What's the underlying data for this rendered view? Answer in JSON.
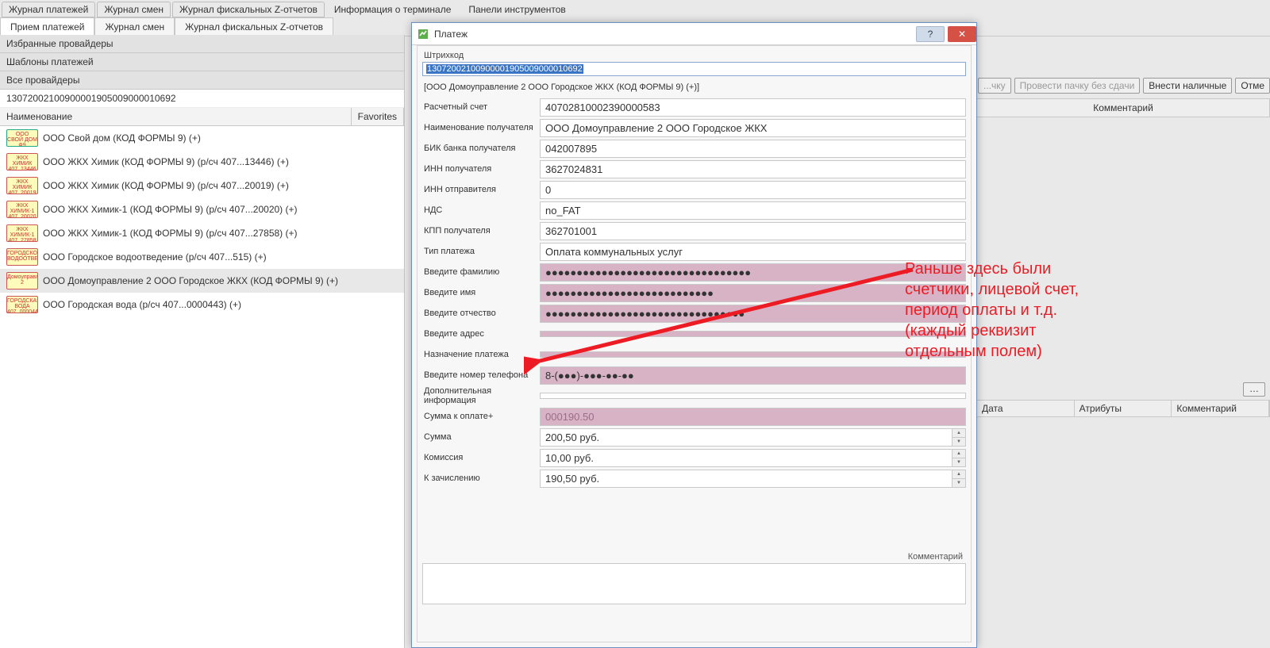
{
  "bgTabsTop": [
    {
      "label": "Журнал платежей"
    },
    {
      "label": "Журнал смен"
    },
    {
      "label": "Журнал фискальных Z-отчетов"
    },
    {
      "label": "Информация о терминале",
      "flat": true
    },
    {
      "label": "Панели инструментов",
      "flat": true
    }
  ],
  "bgTabs2": [
    {
      "label": "Прием платежей",
      "active": true
    },
    {
      "label": "Журнал смен"
    },
    {
      "label": "Журнал фискальных Z-отчетов"
    }
  ],
  "sidebar": {
    "favProv": "Избранные провайдеры",
    "templates": "Шаблоны платежей",
    "allProv": "Все провайдеры",
    "providerNumber": "13072002100900001905009000010692",
    "colName": "Наименование",
    "colFav": "Favorites",
    "items": [
      {
        "label": "ООО Свой дом (КОД ФОРМЫ 9) (+)",
        "logo": "ООО СВОЙ ДОМ Ф9",
        "green": true
      },
      {
        "label": "ООО ЖКХ Химик (КОД ФОРМЫ 9) (р/сч 407...13446) (+)",
        "logo": "ЖКХ ХИМИК 407..13446"
      },
      {
        "label": "ООО ЖКХ Химик (КОД ФОРМЫ 9) (р/сч 407...20019) (+)",
        "logo": "ЖКХ ХИМИК 407..20019"
      },
      {
        "label": "ООО ЖКХ Химик-1 (КОД ФОРМЫ 9) (р/сч 407...20020) (+)",
        "logo": "ЖКХ ХИМИК-1 407..20020"
      },
      {
        "label": "ООО ЖКХ Химик-1 (КОД ФОРМЫ 9) (р/сч 407...27858) (+)",
        "logo": "ЖКХ ХИМИК-1 407..27858"
      },
      {
        "label": "ООО Городское водоотведение (р/сч 407...515) (+)",
        "logo": "ГОРОДСКОЕ ВОДООТВЕДЕНИЕ"
      },
      {
        "label": "ООО Домоуправление 2 ООО Городское ЖКХ (КОД ФОРМЫ 9) (+)",
        "logo": "Домоуправление 2",
        "sel": true
      },
      {
        "label": "ООО Городская вода (р/сч 407...0000443) (+)",
        "logo": "ГОРОДСКАЯ ВОДА 407..0000443"
      }
    ]
  },
  "rightButtons": {
    "pack": "...чку",
    "packNoChange": "Провести пачку без сдачи",
    "cashIn": "Внести наличные",
    "cancel": "Отме"
  },
  "rightHeader": "Комментарий",
  "rightCols": {
    "date": "Дата",
    "attrs": "Атрибуты",
    "comment": "Комментарий"
  },
  "dialog": {
    "title": "Платеж",
    "barcodeLabel": "Штрихкод",
    "barcodeValue": "13072002100900001905009000010692",
    "bracket": "[ООО Домоуправление 2 ООО Городское ЖКХ (КОД ФОРМЫ 9) (+)]",
    "fields": [
      {
        "label": "Расчетный счет",
        "value": "40702810002390000583"
      },
      {
        "label": "Наименование получателя",
        "value": "ООО Домоуправление 2 ООО Городское ЖКХ"
      },
      {
        "label": "БИК банка получателя",
        "value": "042007895"
      },
      {
        "label": "ИНН получателя",
        "value": "3627024831"
      },
      {
        "label": "ИНН отправителя",
        "value": "0"
      },
      {
        "label": "НДС",
        "value": "no_FAT"
      },
      {
        "label": "КПП получателя",
        "value": "362701001"
      },
      {
        "label": "Тип платежа",
        "value": "Оплата коммунальных услуг"
      },
      {
        "label": "Введите фамилию",
        "value": "●●●●●●●●●●●●●●●●●●●●●●●●●●●●●●●●●",
        "req": true
      },
      {
        "label": "Введите имя",
        "value": "●●●●●●●●●●●●●●●●●●●●●●●●●●●",
        "req": true
      },
      {
        "label": "Введите отчество",
        "value": "●●●●●●●●●●●●●●●●●●●●●●●●●●●●●●●●",
        "req": true
      },
      {
        "label": "Введите адрес",
        "value": "",
        "req": true
      },
      {
        "label": "Назначение платежа",
        "value": "",
        "req": true
      },
      {
        "label": "Введите номер телефона",
        "value": "8-(●●●)-●●●-●●-●●",
        "req": true
      },
      {
        "label": "Дополнительная информация",
        "value": ""
      },
      {
        "label": "Сумма к оплате+",
        "value": "000190.50",
        "reqmuted": true
      },
      {
        "label": "Сумма",
        "value": "200,50 руб.",
        "spin": true
      },
      {
        "label": "Комиссия",
        "value": "10,00 руб.",
        "spin": true
      },
      {
        "label": "К зачислению",
        "value": "190,50 руб.",
        "spin": true
      }
    ],
    "commentLabel": "Комментарий"
  },
  "annotation": {
    "l1": "Раньше здесь были",
    "l2": "счетчики, лицевой счет,",
    "l3": "период оплаты и т.д.",
    "l4": "(каждый реквизит",
    "l5": "отдельным полем)"
  }
}
